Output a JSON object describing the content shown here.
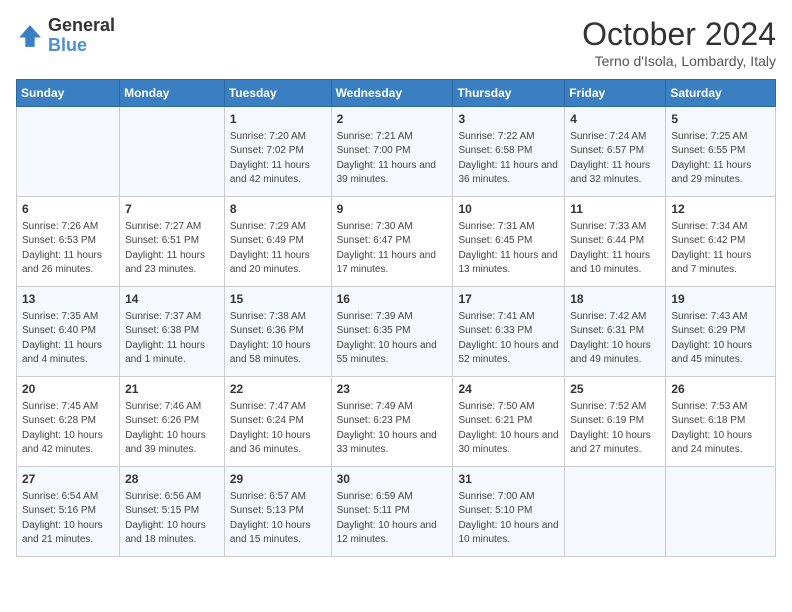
{
  "header": {
    "logo_line1": "General",
    "logo_line2": "Blue",
    "month": "October 2024",
    "location": "Terno d'Isola, Lombardy, Italy"
  },
  "days_of_week": [
    "Sunday",
    "Monday",
    "Tuesday",
    "Wednesday",
    "Thursday",
    "Friday",
    "Saturday"
  ],
  "weeks": [
    [
      {
        "day": "",
        "info": ""
      },
      {
        "day": "",
        "info": ""
      },
      {
        "day": "1",
        "info": "Sunrise: 7:20 AM\nSunset: 7:02 PM\nDaylight: 11 hours and 42 minutes."
      },
      {
        "day": "2",
        "info": "Sunrise: 7:21 AM\nSunset: 7:00 PM\nDaylight: 11 hours and 39 minutes."
      },
      {
        "day": "3",
        "info": "Sunrise: 7:22 AM\nSunset: 6:58 PM\nDaylight: 11 hours and 36 minutes."
      },
      {
        "day": "4",
        "info": "Sunrise: 7:24 AM\nSunset: 6:57 PM\nDaylight: 11 hours and 32 minutes."
      },
      {
        "day": "5",
        "info": "Sunrise: 7:25 AM\nSunset: 6:55 PM\nDaylight: 11 hours and 29 minutes."
      }
    ],
    [
      {
        "day": "6",
        "info": "Sunrise: 7:26 AM\nSunset: 6:53 PM\nDaylight: 11 hours and 26 minutes."
      },
      {
        "day": "7",
        "info": "Sunrise: 7:27 AM\nSunset: 6:51 PM\nDaylight: 11 hours and 23 minutes."
      },
      {
        "day": "8",
        "info": "Sunrise: 7:29 AM\nSunset: 6:49 PM\nDaylight: 11 hours and 20 minutes."
      },
      {
        "day": "9",
        "info": "Sunrise: 7:30 AM\nSunset: 6:47 PM\nDaylight: 11 hours and 17 minutes."
      },
      {
        "day": "10",
        "info": "Sunrise: 7:31 AM\nSunset: 6:45 PM\nDaylight: 11 hours and 13 minutes."
      },
      {
        "day": "11",
        "info": "Sunrise: 7:33 AM\nSunset: 6:44 PM\nDaylight: 11 hours and 10 minutes."
      },
      {
        "day": "12",
        "info": "Sunrise: 7:34 AM\nSunset: 6:42 PM\nDaylight: 11 hours and 7 minutes."
      }
    ],
    [
      {
        "day": "13",
        "info": "Sunrise: 7:35 AM\nSunset: 6:40 PM\nDaylight: 11 hours and 4 minutes."
      },
      {
        "day": "14",
        "info": "Sunrise: 7:37 AM\nSunset: 6:38 PM\nDaylight: 11 hours and 1 minute."
      },
      {
        "day": "15",
        "info": "Sunrise: 7:38 AM\nSunset: 6:36 PM\nDaylight: 10 hours and 58 minutes."
      },
      {
        "day": "16",
        "info": "Sunrise: 7:39 AM\nSunset: 6:35 PM\nDaylight: 10 hours and 55 minutes."
      },
      {
        "day": "17",
        "info": "Sunrise: 7:41 AM\nSunset: 6:33 PM\nDaylight: 10 hours and 52 minutes."
      },
      {
        "day": "18",
        "info": "Sunrise: 7:42 AM\nSunset: 6:31 PM\nDaylight: 10 hours and 49 minutes."
      },
      {
        "day": "19",
        "info": "Sunrise: 7:43 AM\nSunset: 6:29 PM\nDaylight: 10 hours and 45 minutes."
      }
    ],
    [
      {
        "day": "20",
        "info": "Sunrise: 7:45 AM\nSunset: 6:28 PM\nDaylight: 10 hours and 42 minutes."
      },
      {
        "day": "21",
        "info": "Sunrise: 7:46 AM\nSunset: 6:26 PM\nDaylight: 10 hours and 39 minutes."
      },
      {
        "day": "22",
        "info": "Sunrise: 7:47 AM\nSunset: 6:24 PM\nDaylight: 10 hours and 36 minutes."
      },
      {
        "day": "23",
        "info": "Sunrise: 7:49 AM\nSunset: 6:23 PM\nDaylight: 10 hours and 33 minutes."
      },
      {
        "day": "24",
        "info": "Sunrise: 7:50 AM\nSunset: 6:21 PM\nDaylight: 10 hours and 30 minutes."
      },
      {
        "day": "25",
        "info": "Sunrise: 7:52 AM\nSunset: 6:19 PM\nDaylight: 10 hours and 27 minutes."
      },
      {
        "day": "26",
        "info": "Sunrise: 7:53 AM\nSunset: 6:18 PM\nDaylight: 10 hours and 24 minutes."
      }
    ],
    [
      {
        "day": "27",
        "info": "Sunrise: 6:54 AM\nSunset: 5:16 PM\nDaylight: 10 hours and 21 minutes."
      },
      {
        "day": "28",
        "info": "Sunrise: 6:56 AM\nSunset: 5:15 PM\nDaylight: 10 hours and 18 minutes."
      },
      {
        "day": "29",
        "info": "Sunrise: 6:57 AM\nSunset: 5:13 PM\nDaylight: 10 hours and 15 minutes."
      },
      {
        "day": "30",
        "info": "Sunrise: 6:59 AM\nSunset: 5:11 PM\nDaylight: 10 hours and 12 minutes."
      },
      {
        "day": "31",
        "info": "Sunrise: 7:00 AM\nSunset: 5:10 PM\nDaylight: 10 hours and 10 minutes."
      },
      {
        "day": "",
        "info": ""
      },
      {
        "day": "",
        "info": ""
      }
    ]
  ]
}
